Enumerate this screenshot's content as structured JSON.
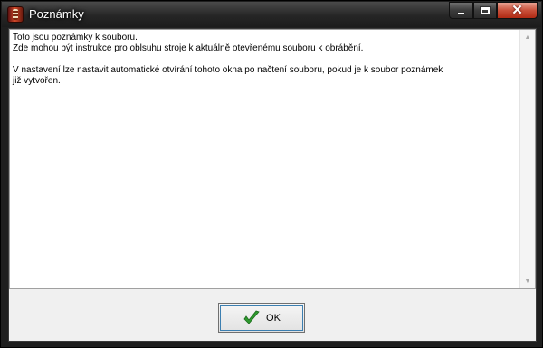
{
  "window": {
    "title": "Poznámky",
    "icon": "spiral-book-icon",
    "caption_buttons": [
      "minimize",
      "maximize",
      "close"
    ]
  },
  "notes": {
    "text": "Toto jsou poznámky k souboru.\nZde mohou být instrukce pro oblsuhu stroje k aktuálně otevřenému souboru k obrábění.\n\nV nastavení lze nastavit automatické otvírání tohoto okna po načtení souboru, pokud je k soubor poznámek\njiž vytvořen."
  },
  "buttons": {
    "ok_label": "OK",
    "ok_icon": "check-icon"
  },
  "colors": {
    "ok_check": "#2e9a2e",
    "close_button": "#c9503a"
  }
}
